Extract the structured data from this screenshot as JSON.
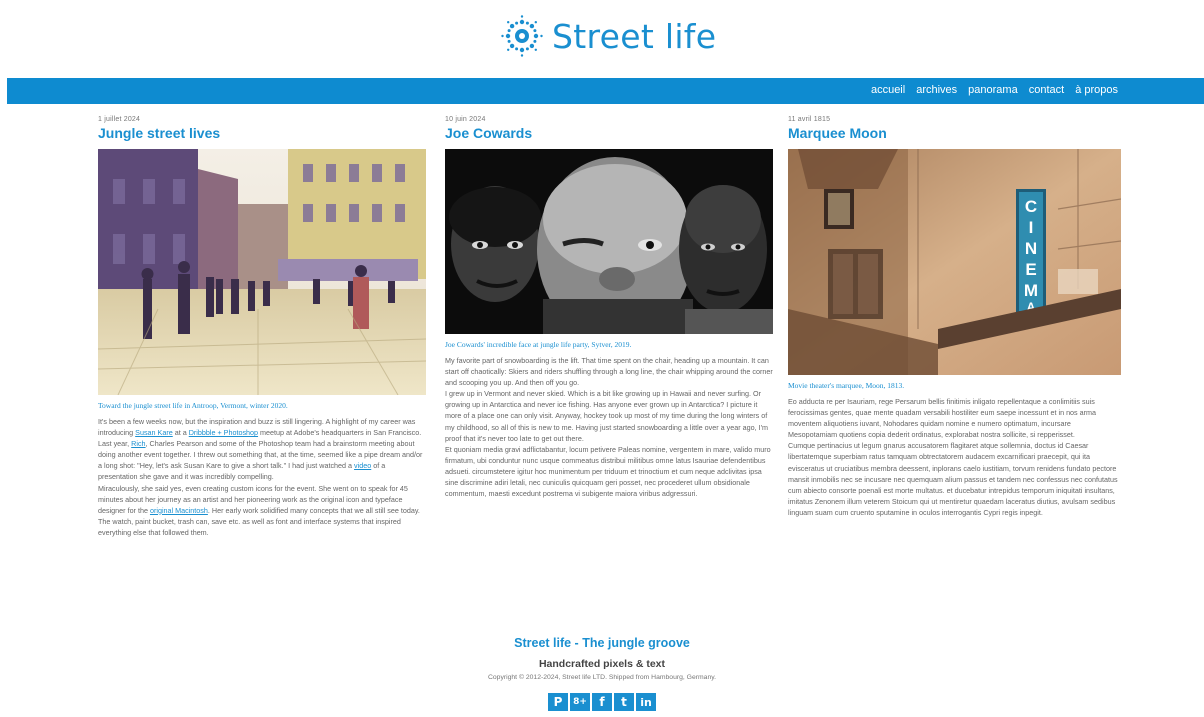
{
  "header": {
    "logo_text": "Street life"
  },
  "nav": {
    "items": [
      "accueil",
      "archives",
      "panorama",
      "contact",
      "à propos"
    ]
  },
  "posts": [
    {
      "date": "1 juillet 2024",
      "title": "Jungle street lives",
      "caption": "Toward the jungle street life in Antroop, Vermont, winter 2020.",
      "para1": {
        "t1": "It's been a few weeks now, but the inspiration and buzz is still lingering. A highlight of my career was introducing ",
        "l1": "Susan Kare",
        "t2": " at a ",
        "l2": "Dribbble + Photoshop",
        "t3": " meetup at Adobe's headquarters in San Francisco. Last year, ",
        "l3": "Rich",
        "t4": ", Charles Pearson and some of the Photoshop team had a brainstorm meeting about doing another event together. I threw out something that, at the time, seemed like a pipe dream and/or a long shot: \"Hey, let's ask Susan Kare to give a short talk.\" I had just watched a ",
        "l4": "video",
        "t5": " of a presentation she gave and it was incredibly compelling."
      },
      "para2": {
        "t1": "Miraculously, she said yes, even creating custom icons for the event. She went on to speak for 45 minutes about her journey as an artist and her pioneering work as the original icon and typeface designer for the ",
        "l1": "original Macintosh",
        "t2": ". Her early work solidified many concepts that we all still see today. The watch, paint bucket, trash can, save etc. as well as font and interface systems that inspired everything else that followed them."
      }
    },
    {
      "date": "10 juin 2024",
      "title": "Joe Cowards",
      "caption": "Joe Cowards' incredible face at jungle life party, Sytver, 2019.",
      "paragraphs": [
        "My favorite part of snowboarding is the lift. That time spent on the chair, heading up a mountain. It can start off chaotically: Skiers and riders shuffling through a long line, the chair whipping around the corner and scooping you up. And then off you go.",
        "I grew up in Vermont and never skied. Which is a bit like growing up in Hawaii and never surfing. Or growing up in Antarctica and never ice fishing. Has anyone ever grown up in Antarctica? I picture it more of a place one can only visit. Anyway, hockey took up most of my time during the long winters of my childhood, so all of this is new to me. Having just started snowboarding a little over a year ago, I'm proof that it's never too late to get out there.",
        "Et quoniam media gravi adflictabantur, locum petivere Paleas nomine, vergentem in mare, valido muro firmatum, ubi conduntur nunc usque commeatus distribui militibus omne latus Isauriae defendentibus adsueti. circumstetere igitur hoc munimentum per triduum et trinoctium et cum neque adclivitas ipsa sine discrimine adiri letali, nec cuniculis quicquam geri posset, nec procederet ullum obsidionale commentum, maesti excedunt postrema vi subigente maiora viribus adgressuri."
      ]
    },
    {
      "date": "11 avril 1815",
      "title": "Marquee Moon",
      "caption": "Movie theater's marquee, Moon, 1813.",
      "paragraphs": [
        "Eo adducta re per Isauriam, rege Persarum bellis finitimis inligato repellentaque a conlimitiis suis ferocissimas gentes, quae mente quadam versabili hostiliter eum saepe incessunt et in nos arma moventem aliquotiens iuvant, Nohodares quidam nomine e numero optimatum, incursare Mesopotamiam quotiens copia dederit ordinatus, explorabat nostra sollicite, si repperisset.",
        "Cumque pertinacius ut legum gnarus accusatorem flagitaret atque sollemnia, doctus id Caesar libertatemque superbiam ratus tamquam obtrectatorem audacem excarnificari praecepit, qui ita evisceratus ut cruciatibus membra deessent, inplorans caelo iustitiam, torvum renidens fundato pectore mansit inmobilis nec se incusare nec quemquam alium passus et tandem nec confessus nec confutatus cum abiecto consorte poenali est morte multatus. et ducebatur intrepidus temporum iniquitati insultans, imitatus Zenonem illum veterem Stoicum qui ut mentiretur quaedam laceratus diutius, avulsam sedibus linguam suam cum cruento sputamine in oculos interrogantis Cypri regis inpegit."
      ]
    }
  ],
  "footer": {
    "title": "Street life - The jungle groove",
    "subtitle": "Handcrafted pixels & text",
    "copyright": "Copyright © 2012-2024, Street life LTD. Shipped from Hambourg, Germany.",
    "social": [
      {
        "icon": "pinterest-icon",
        "glyph": "P"
      },
      {
        "icon": "google-plus-icon",
        "glyph": "8+"
      },
      {
        "icon": "facebook-icon",
        "glyph": "f"
      },
      {
        "icon": "tumblr-icon",
        "glyph": "t"
      },
      {
        "icon": "linkedin-icon",
        "glyph": "in"
      }
    ]
  },
  "colors": {
    "accent": "#1a8fd0",
    "navbar": "#0e8bd0",
    "text": "#666666"
  }
}
